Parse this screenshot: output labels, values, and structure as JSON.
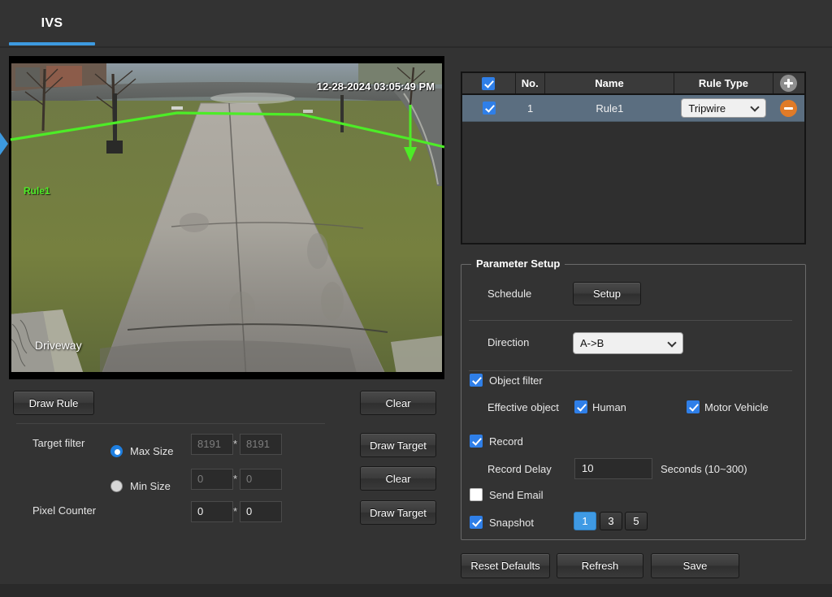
{
  "tab": {
    "label": "IVS",
    "accent": "#3d9ae0"
  },
  "video": {
    "timestamp": "12-28-2024 03:05:49 PM",
    "channel_name": "Driveway",
    "rule_overlay_label": "Rule1",
    "rule_color": "#4dec27"
  },
  "draw_controls": {
    "draw_rule": "Draw Rule",
    "clear_rule": "Clear",
    "draw_target_1": "Draw Target",
    "clear_target": "Clear",
    "draw_target_2": "Draw Target"
  },
  "target_filter": {
    "label": "Target filter",
    "max_size_label": "Max Size",
    "min_size_label": "Min Size",
    "pixel_counter_label": "Pixel Counter",
    "selected": "Max Size",
    "max_width": "8191",
    "max_height": "8191",
    "min_width": "0",
    "min_height": "0",
    "pixel_width": "0",
    "pixel_height": "0",
    "separator": "*"
  },
  "rule_table": {
    "header_select_all_checked": true,
    "columns": [
      "No.",
      "Name",
      "Rule Type"
    ],
    "add_label": "+",
    "rows": [
      {
        "checked": true,
        "no": "1",
        "name": "Rule1",
        "rule_type": "Tripwire",
        "remove_label": "-"
      }
    ]
  },
  "parameter_setup": {
    "legend": "Parameter Setup",
    "schedule_label": "Schedule",
    "schedule_button": "Setup",
    "direction_label": "Direction",
    "direction_value": "A->B",
    "object_filter_label": "Object filter",
    "object_filter_checked": true,
    "effective_object_label": "Effective object",
    "human_label": "Human",
    "human_checked": true,
    "motor_vehicle_label": "Motor Vehicle",
    "motor_vehicle_checked": true,
    "record_label": "Record",
    "record_checked": true,
    "record_delay_label": "Record Delay",
    "record_delay_value": "10",
    "record_delay_units": "Seconds  (10~300)",
    "send_email_label": "Send Email",
    "send_email_checked": false,
    "snapshot_label": "Snapshot",
    "snapshot_checked": true,
    "snapshot_options": [
      "1",
      "3",
      "5"
    ],
    "snapshot_selected": "1"
  },
  "actions": {
    "reset": "Reset Defaults",
    "refresh": "Refresh",
    "save": "Save"
  }
}
